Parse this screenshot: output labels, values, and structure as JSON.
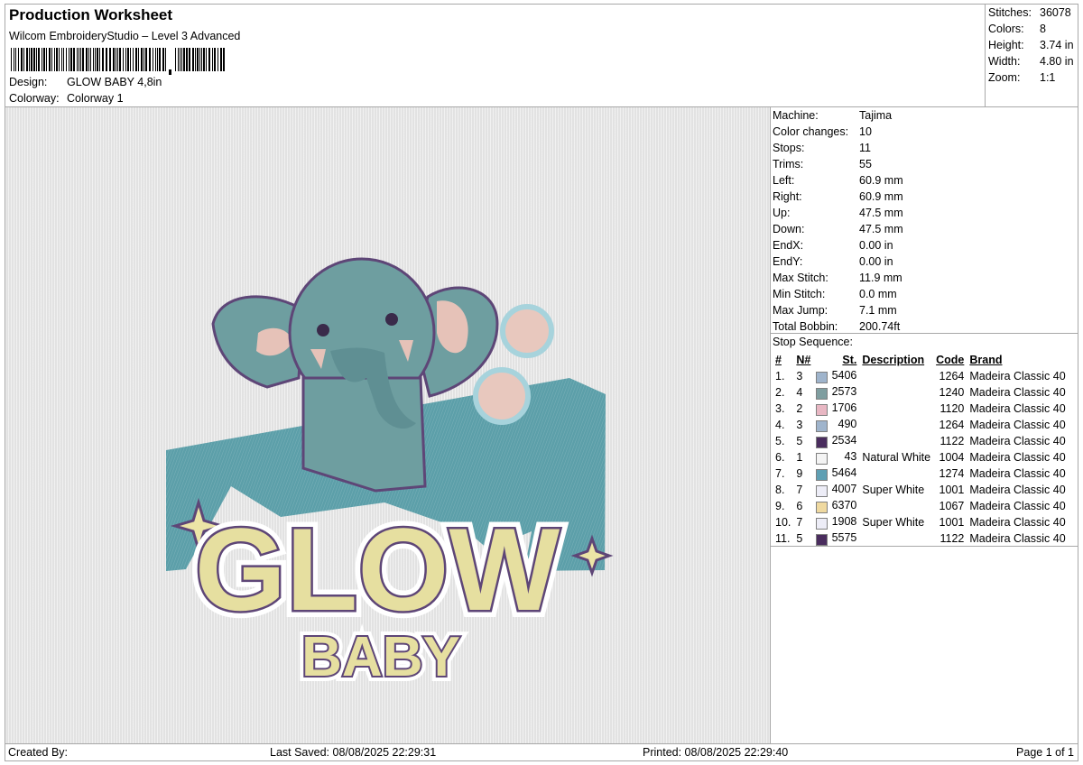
{
  "header": {
    "title": "Production Worksheet",
    "software": "Wilcom EmbroideryStudio – Level 3 Advanced",
    "design_label": "Design:",
    "design_value": "GLOW BABY 4,8in",
    "colorway_label": "Colorway:",
    "colorway_value": "Colorway 1"
  },
  "summary": [
    {
      "label": "Stitches:",
      "value": "36078"
    },
    {
      "label": "Colors:",
      "value": "8"
    },
    {
      "label": "Height:",
      "value": "3.74 in"
    },
    {
      "label": "Width:",
      "value": "4.80 in"
    },
    {
      "label": "Zoom:",
      "value": "1:1"
    }
  ],
  "machine_info": [
    {
      "label": "Machine:",
      "value": "Tajima"
    },
    {
      "label": "Color changes:",
      "value": "10"
    },
    {
      "label": "Stops:",
      "value": "11"
    },
    {
      "label": "Trims:",
      "value": "55"
    },
    {
      "label": "Left:",
      "value": "60.9 mm"
    },
    {
      "label": "Right:",
      "value": "60.9 mm"
    },
    {
      "label": "Up:",
      "value": "47.5 mm"
    },
    {
      "label": "Down:",
      "value": "47.5 mm"
    },
    {
      "label": "EndX:",
      "value": "0.00 in"
    },
    {
      "label": "EndY:",
      "value": "0.00 in"
    },
    {
      "label": "Max Stitch:",
      "value": "11.9 mm"
    },
    {
      "label": "Min Stitch:",
      "value": "0.0 mm"
    },
    {
      "label": "Max Jump:",
      "value": "7.1 mm"
    },
    {
      "label": "Total Bobbin:",
      "value": "200.74ft"
    }
  ],
  "stop_sequence": {
    "title": "Stop Sequence:",
    "columns": [
      "#",
      "N#",
      "St.",
      "Description",
      "Code",
      "Brand"
    ],
    "rows": [
      {
        "num": "1.",
        "n": "3",
        "color": "#9fb4cc",
        "st": "5406",
        "desc": "",
        "code": "1264",
        "brand": "Madeira Classic 40"
      },
      {
        "num": "2.",
        "n": "4",
        "color": "#7f9ea0",
        "st": "2573",
        "desc": "",
        "code": "1240",
        "brand": "Madeira Classic 40"
      },
      {
        "num": "3.",
        "n": "2",
        "color": "#e8b7c3",
        "st": "1706",
        "desc": "",
        "code": "1120",
        "brand": "Madeira Classic 40"
      },
      {
        "num": "4.",
        "n": "3",
        "color": "#9fb4cc",
        "st": "490",
        "desc": "",
        "code": "1264",
        "brand": "Madeira Classic 40"
      },
      {
        "num": "5.",
        "n": "5",
        "color": "#4a2d5e",
        "st": "2534",
        "desc": "",
        "code": "1122",
        "brand": "Madeira Classic 40"
      },
      {
        "num": "6.",
        "n": "1",
        "color": "#f4f4f4",
        "st": "43",
        "desc": "Natural White",
        "code": "1004",
        "brand": "Madeira Classic 40"
      },
      {
        "num": "7.",
        "n": "9",
        "color": "#5f9fb3",
        "st": "5464",
        "desc": "",
        "code": "1274",
        "brand": "Madeira Classic 40"
      },
      {
        "num": "8.",
        "n": "7",
        "color": "#ededf7",
        "st": "4007",
        "desc": "Super White",
        "code": "1001",
        "brand": "Madeira Classic 40"
      },
      {
        "num": "9.",
        "n": "6",
        "color": "#efd9a0",
        "st": "6370",
        "desc": "",
        "code": "1067",
        "brand": "Madeira Classic 40"
      },
      {
        "num": "10.",
        "n": "7",
        "color": "#ededf7",
        "st": "1908",
        "desc": "Super White",
        "code": "1001",
        "brand": "Madeira Classic 40"
      },
      {
        "num": "11.",
        "n": "5",
        "color": "#4a2d5e",
        "st": "5575",
        "desc": "",
        "code": "1122",
        "brand": "Madeira Classic 40"
      }
    ]
  },
  "design_text": {
    "word1": "GLOW",
    "word2": "BABY"
  },
  "footer": {
    "created_by": "Created By:",
    "last_saved": "Last Saved: 08/08/2025 22:29:31",
    "printed": "Printed: 08/08/2025 22:29:40",
    "page": "Page 1 of 1"
  }
}
